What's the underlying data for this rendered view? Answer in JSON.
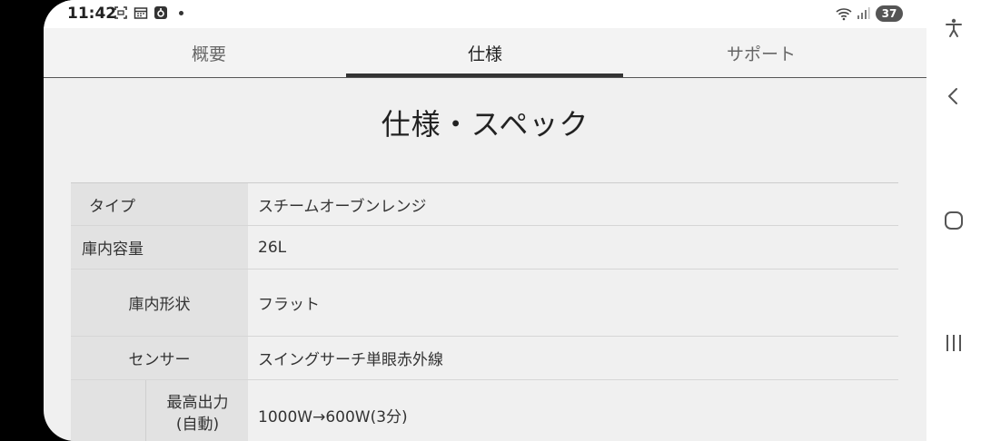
{
  "status_bar": {
    "time": "11:42",
    "battery": "37"
  },
  "tabs": [
    {
      "label": "概要"
    },
    {
      "label": "仕様"
    },
    {
      "label": "サポート"
    }
  ],
  "page_title": "仕様・スペック",
  "spec_rows": [
    {
      "label": "タイプ",
      "value": "スチームオーブンレンジ"
    },
    {
      "label": "庫内容量",
      "value": "26L"
    },
    {
      "label": "庫内形状",
      "value": "フラット"
    },
    {
      "label": "センサー",
      "value": "スイングサーチ単眼赤外線"
    },
    {
      "sub_label_line1": "最高出力",
      "sub_label_line2": "(自動)",
      "value": "1000W→600W(3分)"
    }
  ],
  "icons": {
    "accessibility": "accessibility-icon",
    "back": "back-icon",
    "home": "home-icon",
    "recents": "recents-icon"
  }
}
